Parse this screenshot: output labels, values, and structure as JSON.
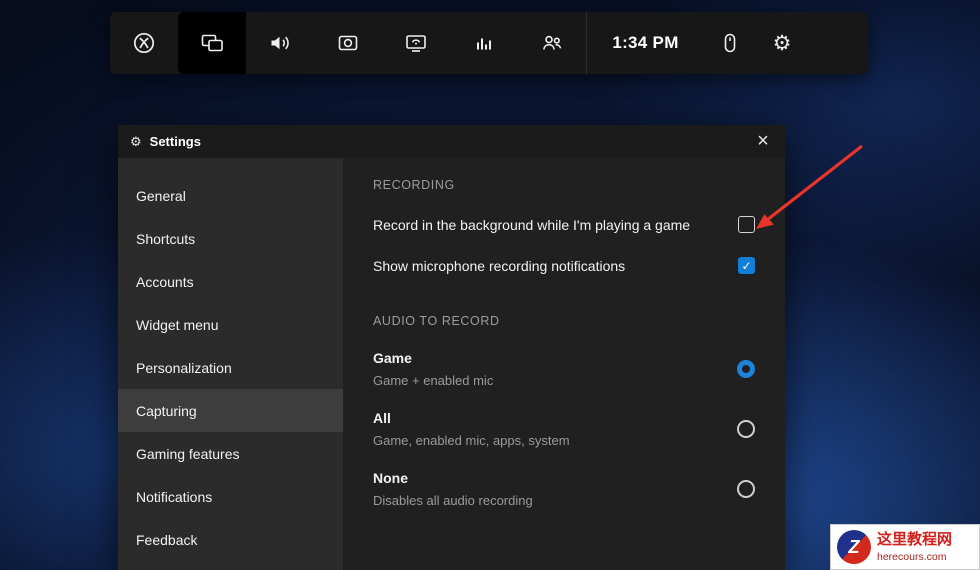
{
  "colors": {
    "accent": "#0f7fd7",
    "arrow_red": "#e8352a",
    "selected_nav_bg": "#3d3d3d",
    "watermark_red": "#d0211c",
    "watermark_blue": "#20308d"
  },
  "gamebar": {
    "time": "1:34 PM",
    "icons": [
      "xbox-logo",
      "widgets",
      "audio",
      "capture",
      "broadcast",
      "performance",
      "looking-for-group",
      "mouse",
      "settings-gear"
    ]
  },
  "settings": {
    "title": "Settings",
    "close_label": "×",
    "sidebar": {
      "items": [
        {
          "label": "General",
          "selected": false
        },
        {
          "label": "Shortcuts",
          "selected": false
        },
        {
          "label": "Accounts",
          "selected": false
        },
        {
          "label": "Widget menu",
          "selected": false
        },
        {
          "label": "Personalization",
          "selected": false
        },
        {
          "label": "Capturing",
          "selected": true
        },
        {
          "label": "Gaming features",
          "selected": false
        },
        {
          "label": "Notifications",
          "selected": false
        },
        {
          "label": "Feedback",
          "selected": false
        }
      ]
    },
    "content": {
      "recording": {
        "header": "RECORDING",
        "options": [
          {
            "label": "Record in the background while I'm playing a game",
            "checked": false
          },
          {
            "label": "Show microphone recording notifications",
            "checked": true
          }
        ]
      },
      "audio": {
        "header": "AUDIO TO RECORD",
        "options": [
          {
            "label": "Game",
            "description": "Game + enabled mic",
            "selected": true
          },
          {
            "label": "All",
            "description": "Game, enabled mic, apps, system",
            "selected": false
          },
          {
            "label": "None",
            "description": "Disables all audio recording",
            "selected": false
          }
        ]
      }
    }
  },
  "watermark": {
    "title": "这里教程网",
    "url": "herecours.com"
  }
}
